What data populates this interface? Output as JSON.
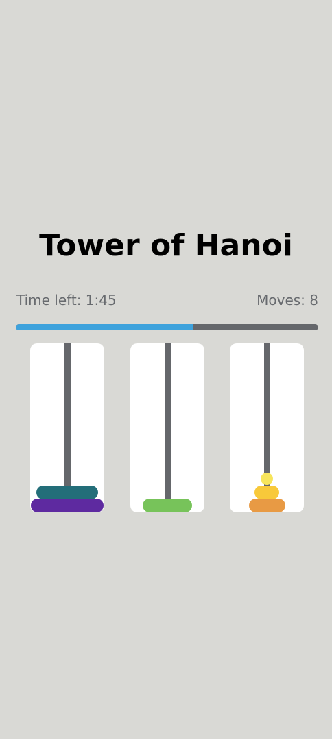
{
  "title": "Tower of Hanoi",
  "stats": {
    "time_left": "Time left: 1:45",
    "moves": "Moves: 8"
  },
  "progress": {
    "fraction": 0.585,
    "fill_color": "#3ea2dc",
    "track_color": "#65676b"
  },
  "rods": [
    {
      "disks": [
        {
          "size": 7,
          "color": "#5e2aa0"
        },
        {
          "size": 6,
          "color": "#236e79"
        }
      ]
    },
    {
      "disks": [
        {
          "size": 5,
          "color": "#77c35a"
        }
      ]
    },
    {
      "disks": [
        {
          "size": 4,
          "color": "#e89a44"
        },
        {
          "size": 3,
          "color": "#f8c93a"
        },
        {
          "size": 2,
          "color": "#f7e55c"
        }
      ]
    }
  ]
}
